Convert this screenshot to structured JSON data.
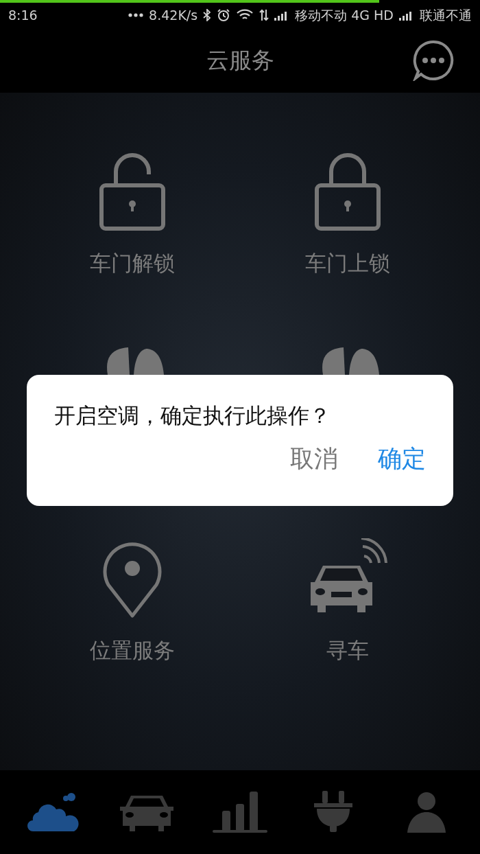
{
  "status_bar": {
    "time": "8:16",
    "speed": "8.42K/s",
    "carrier_1": "移动不动 4G HD",
    "carrier_2": "联通不通"
  },
  "header": {
    "title": "云服务"
  },
  "tiles": [
    {
      "kind": "unlock",
      "label": "车门解锁"
    },
    {
      "kind": "lock",
      "label": "车门上锁"
    },
    {
      "kind": "fan"
    },
    {
      "kind": "fan"
    },
    {
      "kind": "location",
      "label": "位置服务"
    },
    {
      "kind": "find-car",
      "label": "寻车"
    }
  ],
  "dialog": {
    "message": "开启空调，确定执行此操作？",
    "buttons": [
      {
        "kind": "cancel",
        "label": "取消"
      },
      {
        "kind": "confirm",
        "label": "确定"
      }
    ]
  },
  "bottom_nav": [
    {
      "kind": "cloud",
      "selected": true
    },
    {
      "kind": "car",
      "selected": false
    },
    {
      "kind": "chart",
      "selected": false
    },
    {
      "kind": "plug",
      "selected": false
    },
    {
      "kind": "person",
      "selected": false
    }
  ]
}
